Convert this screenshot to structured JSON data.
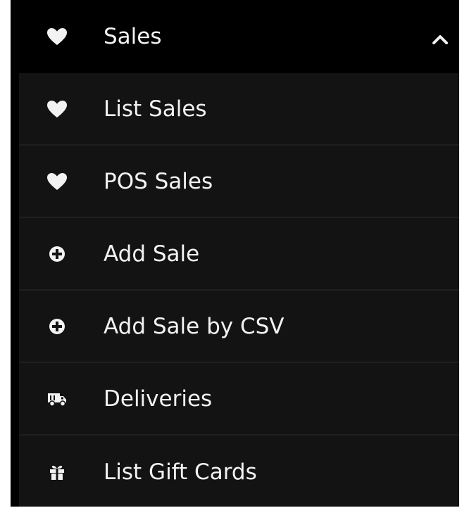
{
  "menu": {
    "header": {
      "label": "Sales",
      "icon": "heart-icon",
      "toggle_icon": "chevron-up-icon"
    },
    "items": [
      {
        "label": "List Sales",
        "icon": "heart-icon"
      },
      {
        "label": "POS Sales",
        "icon": "heart-icon"
      },
      {
        "label": "Add Sale",
        "icon": "plus-circle-icon"
      },
      {
        "label": "Add Sale by CSV",
        "icon": "plus-circle-icon"
      },
      {
        "label": "Deliveries",
        "icon": "truck-icon"
      },
      {
        "label": "List Gift Cards",
        "icon": "gift-icon"
      }
    ]
  },
  "colors": {
    "header_bg": "#000000",
    "item_bg": "#131313",
    "divider": "#1f1f1f",
    "text": "#f2f2f2"
  }
}
